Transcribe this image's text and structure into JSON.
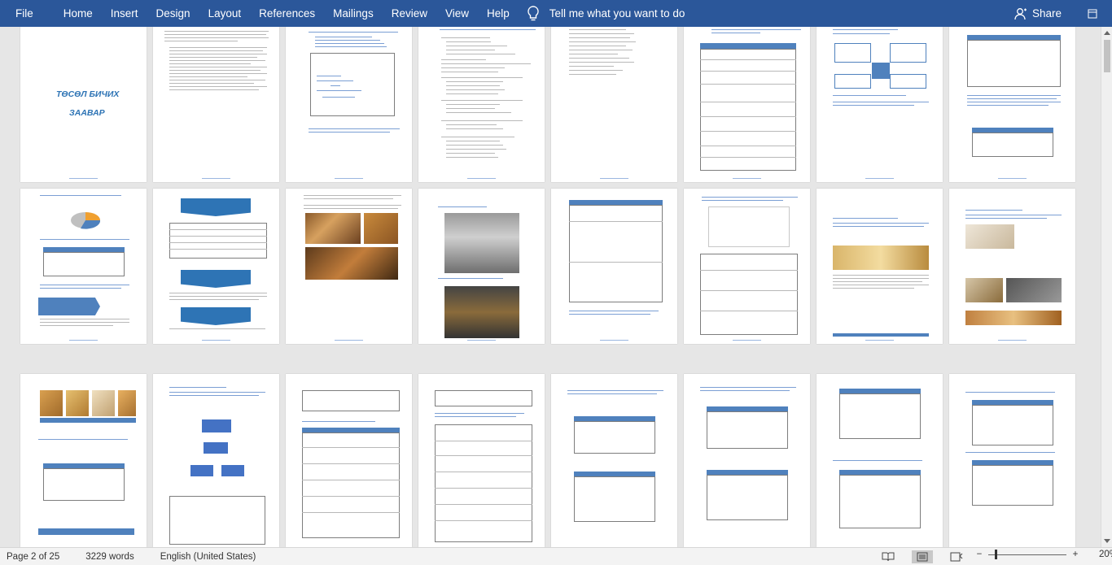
{
  "ribbon": {
    "tabs": [
      "File",
      "Home",
      "Insert",
      "Design",
      "Layout",
      "References",
      "Mailings",
      "Review",
      "View",
      "Help"
    ],
    "tell_me": "Tell me what you want to do",
    "share": "Share"
  },
  "document": {
    "cover_title_line1": "ТӨСӨЛ БИЧИХ",
    "cover_title_line2": "ЗААВАР",
    "section_titles": {
      "p2_3_a": "БҮТЭЭГДЭХҮҮНИЙ ТЕХНИК ҮЗҮҮЛЭЛТ",
      "p2_3_b": "БҮТЭЭГДЭХҮҮНИЙ ОНЦЛОГ",
      "p2_3_c": "АНХААРАХ ЗҮЙЛС",
      "p2_2": "БҮТЭЭГДЭХҮҮНИЙ ТАНИЛЦУУЛГА"
    }
  },
  "status": {
    "page": "Page 2 of 25",
    "words": "3229 words",
    "language": "English (United States)",
    "zoom": "20%",
    "zoom_level_percent": 20
  },
  "colors": {
    "ribbon": "#2b579a",
    "accent": "#4f81bd"
  }
}
